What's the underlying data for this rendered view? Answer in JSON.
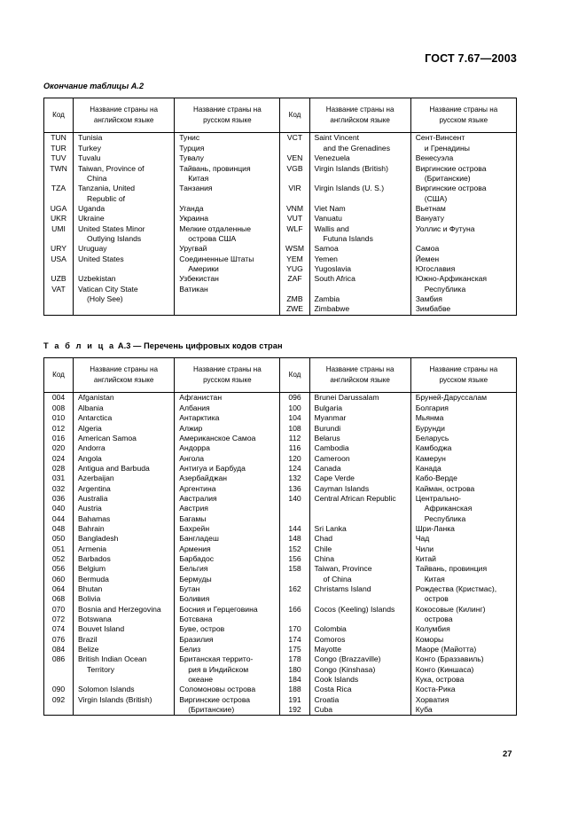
{
  "document": {
    "standard_header": "ГОСТ 7.67—2003",
    "page_number": "27"
  },
  "table_a2": {
    "caption": "Окончание таблицы  А.2",
    "headers": {
      "code": "Код",
      "english_l1": "Название страны на",
      "english_l2": "английском языке",
      "russian_l1": "Название страны на",
      "russian_l2": "русском языке"
    },
    "left_rows": [
      {
        "code": "TUN",
        "en": [
          "Tunisia"
        ],
        "ru": [
          "Тунис"
        ]
      },
      {
        "code": "TUR",
        "en": [
          "Turkey"
        ],
        "ru": [
          "Турция"
        ]
      },
      {
        "code": "TUV",
        "en": [
          "Tuvalu"
        ],
        "ru": [
          "Тувалу"
        ]
      },
      {
        "code": "TWN",
        "en": [
          "Taiwan, Province of",
          "China"
        ],
        "ru": [
          "Тайвань, провинция",
          "Китая"
        ]
      },
      {
        "code": "TZA",
        "en": [
          "Tanzania, United",
          "Republic of"
        ],
        "ru": [
          "Танзания",
          ""
        ]
      },
      {
        "code": "UGA",
        "en": [
          "Uganda"
        ],
        "ru": [
          "Уганда"
        ]
      },
      {
        "code": "UKR",
        "en": [
          "Ukraine"
        ],
        "ru": [
          "Украина"
        ]
      },
      {
        "code": "UMI",
        "en": [
          "United States Minor",
          "Outlying Islands"
        ],
        "ru": [
          "Мелкие отдаленные",
          "острова США"
        ]
      },
      {
        "code": "URY",
        "en": [
          "Uruguay"
        ],
        "ru": [
          "Уругвай"
        ]
      },
      {
        "code": "USA",
        "en": [
          "United States",
          ""
        ],
        "ru": [
          "Соединенные Штаты",
          "Америки"
        ]
      },
      {
        "code": "UZB",
        "en": [
          "Uzbekistan"
        ],
        "ru": [
          "Узбекистан"
        ]
      },
      {
        "code": "VAT",
        "en": [
          "Vatican City State",
          "(Holy See)"
        ],
        "ru": [
          "Ватикан",
          ""
        ]
      }
    ],
    "right_rows": [
      {
        "code": "VCT",
        "en": [
          "Saint Vincent",
          "and the Grenadines"
        ],
        "ru": [
          "Сент-Винсент",
          "и Гренадины"
        ]
      },
      {
        "code": "VEN",
        "en": [
          "Venezuela"
        ],
        "ru": [
          "Венесуэла"
        ]
      },
      {
        "code": "VGB",
        "en": [
          "Virgin Islands (British)",
          ""
        ],
        "ru": [
          "Виргинские острова",
          "(Британские)"
        ]
      },
      {
        "code": "VIR",
        "en": [
          "Virgin Islands (U. S.)",
          ""
        ],
        "ru": [
          "Виргинские острова",
          "(США)"
        ]
      },
      {
        "code": "VNM",
        "en": [
          "Viet Nam"
        ],
        "ru": [
          "Вьетнам"
        ]
      },
      {
        "code": "VUT",
        "en": [
          "Vanuatu"
        ],
        "ru": [
          "Вануату"
        ]
      },
      {
        "code": "WLF",
        "en": [
          "Wallis and",
          "Futuna Islands"
        ],
        "ru": [
          "Уоллис и Футуна",
          ""
        ]
      },
      {
        "code": "WSM",
        "en": [
          "Samoa"
        ],
        "ru": [
          "Самоа"
        ]
      },
      {
        "code": "YEM",
        "en": [
          "Yemen"
        ],
        "ru": [
          "Йемен"
        ]
      },
      {
        "code": "YUG",
        "en": [
          "Yugoslavia"
        ],
        "ru": [
          "Югославия"
        ]
      },
      {
        "code": "ZAF",
        "en": [
          "South Africa",
          ""
        ],
        "ru": [
          "Южно-Арфиканская",
          "Республика"
        ]
      },
      {
        "code": "ZMB",
        "en": [
          "Zambia"
        ],
        "ru": [
          "Замбия"
        ]
      },
      {
        "code": "ZWE",
        "en": [
          "Zimbabwe"
        ],
        "ru": [
          "Зимбабве"
        ]
      }
    ]
  },
  "table_a3": {
    "caption_spaced": "Т а б л и ц а",
    "caption_rest": "  А.3 — Перечень цифровых кодов стран",
    "headers": {
      "code": "Код",
      "english_l1": "Название страны на",
      "english_l2": "английском языке",
      "russian_l1": "Название страны на",
      "russian_l2": "русском языке"
    },
    "left_rows": [
      {
        "code": "004",
        "en": [
          "Afganistan"
        ],
        "ru": [
          "Афганистан"
        ]
      },
      {
        "code": "008",
        "en": [
          "Albania"
        ],
        "ru": [
          "Албания"
        ]
      },
      {
        "code": "010",
        "en": [
          "Antarctica"
        ],
        "ru": [
          "Антарктика"
        ]
      },
      {
        "code": "012",
        "en": [
          "Algeria"
        ],
        "ru": [
          "Алжир"
        ]
      },
      {
        "code": "016",
        "en": [
          "American Samoa"
        ],
        "ru": [
          "Американское Самоа"
        ]
      },
      {
        "code": "020",
        "en": [
          "Andorra"
        ],
        "ru": [
          "Андорра"
        ]
      },
      {
        "code": "024",
        "en": [
          "Angola"
        ],
        "ru": [
          "Ангола"
        ]
      },
      {
        "code": "028",
        "en": [
          "Antigua and Barbuda"
        ],
        "ru": [
          "Антигуа и Барбуда"
        ]
      },
      {
        "code": "031",
        "en": [
          "Azerbaijan"
        ],
        "ru": [
          "Азербайджан"
        ]
      },
      {
        "code": "032",
        "en": [
          "Argentina"
        ],
        "ru": [
          "Аргентина"
        ]
      },
      {
        "code": "036",
        "en": [
          "Australia"
        ],
        "ru": [
          "Австралия"
        ]
      },
      {
        "code": "040",
        "en": [
          "Austria"
        ],
        "ru": [
          "Австрия"
        ]
      },
      {
        "code": "044",
        "en": [
          "Bahamas"
        ],
        "ru": [
          "Багамы"
        ]
      },
      {
        "code": "048",
        "en": [
          "Bahrain"
        ],
        "ru": [
          "Бахрейн"
        ]
      },
      {
        "code": "050",
        "en": [
          "Bangladesh"
        ],
        "ru": [
          "Бангладеш"
        ]
      },
      {
        "code": "051",
        "en": [
          "Armenia"
        ],
        "ru": [
          "Армения"
        ]
      },
      {
        "code": "052",
        "en": [
          "Barbados"
        ],
        "ru": [
          "Барбадос"
        ]
      },
      {
        "code": "056",
        "en": [
          "Belgium"
        ],
        "ru": [
          "Бельгия"
        ]
      },
      {
        "code": "060",
        "en": [
          "Bermuda"
        ],
        "ru": [
          "Бермуды"
        ]
      },
      {
        "code": "064",
        "en": [
          "Bhutan"
        ],
        "ru": [
          "Бутан"
        ]
      },
      {
        "code": "068",
        "en": [
          "Bolivia"
        ],
        "ru": [
          "Боливия"
        ]
      },
      {
        "code": "070",
        "en": [
          "Bosnia and Herzegovina"
        ],
        "ru": [
          "Босния и Герцеговина"
        ]
      },
      {
        "code": "072",
        "en": [
          "Botswana"
        ],
        "ru": [
          "Ботсвана"
        ]
      },
      {
        "code": "074",
        "en": [
          "Bouvet Island"
        ],
        "ru": [
          "Буве, остров"
        ]
      },
      {
        "code": "076",
        "en": [
          "Brazil"
        ],
        "ru": [
          "Бразилия"
        ]
      },
      {
        "code": "084",
        "en": [
          "Belize"
        ],
        "ru": [
          "Белиз"
        ]
      },
      {
        "code": "086",
        "en": [
          "British Indian Ocean",
          "Territory",
          ""
        ],
        "ru": [
          "Британская террито-",
          "рия в Индийском",
          "океане"
        ]
      },
      {
        "code": "090",
        "en": [
          "Solomon Islands"
        ],
        "ru": [
          "Соломоновы острова"
        ]
      },
      {
        "code": "092",
        "en": [
          "Virgin Islands (British)",
          ""
        ],
        "ru": [
          "Виргинские острова",
          "(Британские)"
        ]
      }
    ],
    "right_rows": [
      {
        "code": "096",
        "en": [
          "Brunei Darussalam"
        ],
        "ru": [
          "Бруней-Даруссалам"
        ]
      },
      {
        "code": "100",
        "en": [
          "Bulgaria"
        ],
        "ru": [
          "Болгария"
        ]
      },
      {
        "code": "104",
        "en": [
          "Myanmar"
        ],
        "ru": [
          "Мьянма"
        ]
      },
      {
        "code": "108",
        "en": [
          "Burundi"
        ],
        "ru": [
          "Бурунди"
        ]
      },
      {
        "code": "112",
        "en": [
          "Belarus"
        ],
        "ru": [
          "Беларусь"
        ]
      },
      {
        "code": "116",
        "en": [
          "Cambodia"
        ],
        "ru": [
          "Камбоджа"
        ]
      },
      {
        "code": "120",
        "en": [
          "Cameroon"
        ],
        "ru": [
          "Камерун"
        ]
      },
      {
        "code": "124",
        "en": [
          "Canada"
        ],
        "ru": [
          "Канада"
        ]
      },
      {
        "code": "132",
        "en": [
          "Cape Verde"
        ],
        "ru": [
          "Кабо-Верде"
        ]
      },
      {
        "code": "136",
        "en": [
          "Cayman Islands"
        ],
        "ru": [
          "Кайман, острова"
        ]
      },
      {
        "code": "140",
        "en": [
          "Central African Republic",
          "",
          ""
        ],
        "ru": [
          "Центрально-",
          "Африканская",
          "Республика"
        ]
      },
      {
        "code": "144",
        "en": [
          "Sri Lanka"
        ],
        "ru": [
          "Шри-Ланка"
        ]
      },
      {
        "code": "148",
        "en": [
          "Chad"
        ],
        "ru": [
          "Чад"
        ]
      },
      {
        "code": "152",
        "en": [
          "Chile"
        ],
        "ru": [
          "Чили"
        ]
      },
      {
        "code": "156",
        "en": [
          "China"
        ],
        "ru": [
          "Китай"
        ]
      },
      {
        "code": "158",
        "en": [
          "Taiwan, Province",
          "of China"
        ],
        "ru": [
          "Тайвань, провинция",
          "Китая"
        ]
      },
      {
        "code": "162",
        "en": [
          "Christams Island",
          ""
        ],
        "ru": [
          "Рождества (Кристмас),",
          "остров"
        ]
      },
      {
        "code": "166",
        "en": [
          "Cocos (Keeling) Islands",
          ""
        ],
        "ru": [
          "Кокосовые (Килинг)",
          "острова"
        ]
      },
      {
        "code": "170",
        "en": [
          "Colombia"
        ],
        "ru": [
          "Колумбия"
        ]
      },
      {
        "code": "174",
        "en": [
          "Comoros"
        ],
        "ru": [
          "Коморы"
        ]
      },
      {
        "code": "175",
        "en": [
          "Mayotte"
        ],
        "ru": [
          "Маоре (Майотта)"
        ]
      },
      {
        "code": "178",
        "en": [
          "Congo (Brazzaville)"
        ],
        "ru": [
          "Конго (Браззавиль)"
        ]
      },
      {
        "code": "180",
        "en": [
          "Congo (Kinshasa)"
        ],
        "ru": [
          "Конго (Киншаса)"
        ]
      },
      {
        "code": "184",
        "en": [
          "Cook Islands"
        ],
        "ru": [
          "Кука, острова"
        ]
      },
      {
        "code": "188",
        "en": [
          "Costa Rica"
        ],
        "ru": [
          "Коста-Рика"
        ]
      },
      {
        "code": "191",
        "en": [
          "Croatia"
        ],
        "ru": [
          "Хорватия"
        ]
      },
      {
        "code": "192",
        "en": [
          "Cuba"
        ],
        "ru": [
          "Куба"
        ]
      }
    ]
  }
}
